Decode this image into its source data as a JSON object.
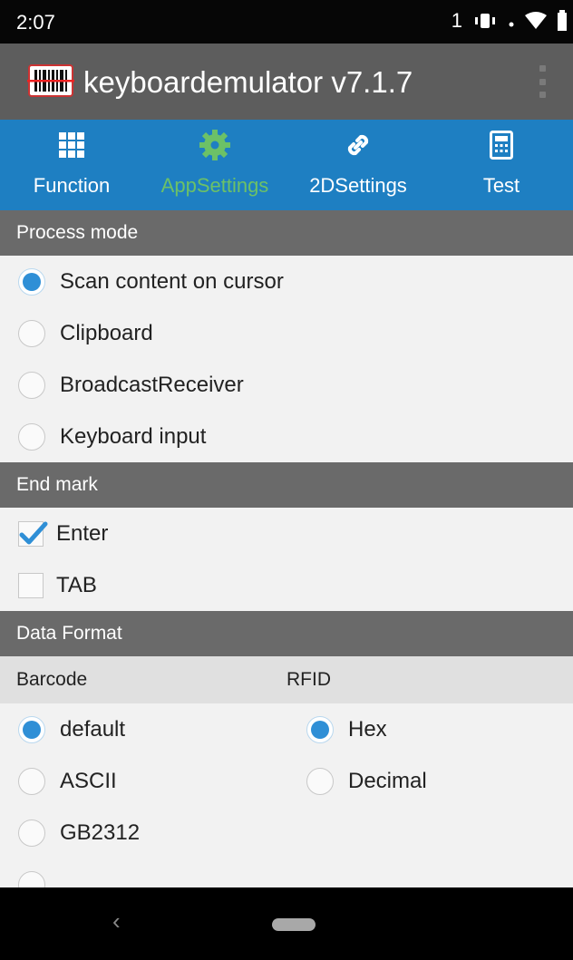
{
  "status_bar": {
    "time": "2:07",
    "sim": "1"
  },
  "app_bar": {
    "title": "keyboardemulator v7.1.7"
  },
  "tabs": [
    {
      "label": "Function",
      "icon": "grid-icon",
      "active": false
    },
    {
      "label": "AppSettings",
      "icon": "gear-icon",
      "active": true
    },
    {
      "label": "2DSettings",
      "icon": "link-icon",
      "active": false
    },
    {
      "label": "Test",
      "icon": "calculator-icon",
      "active": false
    }
  ],
  "process_mode": {
    "header": "Process mode",
    "options": [
      {
        "label": "Scan content on cursor",
        "selected": true
      },
      {
        "label": "Clipboard",
        "selected": false
      },
      {
        "label": "BroadcastReceiver",
        "selected": false
      },
      {
        "label": "Keyboard input",
        "selected": false
      }
    ]
  },
  "end_mark": {
    "header": "End mark",
    "options": [
      {
        "label": "Enter",
        "checked": true
      },
      {
        "label": "TAB",
        "checked": false
      }
    ]
  },
  "data_format": {
    "header": "Data Format",
    "barcode": {
      "header": "Barcode",
      "options": [
        {
          "label": "default",
          "selected": true
        },
        {
          "label": "ASCII",
          "selected": false
        },
        {
          "label": "GB2312",
          "selected": false
        }
      ]
    },
    "rfid": {
      "header": "RFID",
      "options": [
        {
          "label": "Hex",
          "selected": true
        },
        {
          "label": "Decimal",
          "selected": false
        }
      ]
    }
  },
  "nav_bar": {
    "back_glyph": "‹"
  },
  "colors": {
    "tab_bar": "#1e7fc2",
    "active_tab": "#6cc167",
    "radio_selected": "#2f8fd6",
    "section_header": "#6a6a6a"
  }
}
